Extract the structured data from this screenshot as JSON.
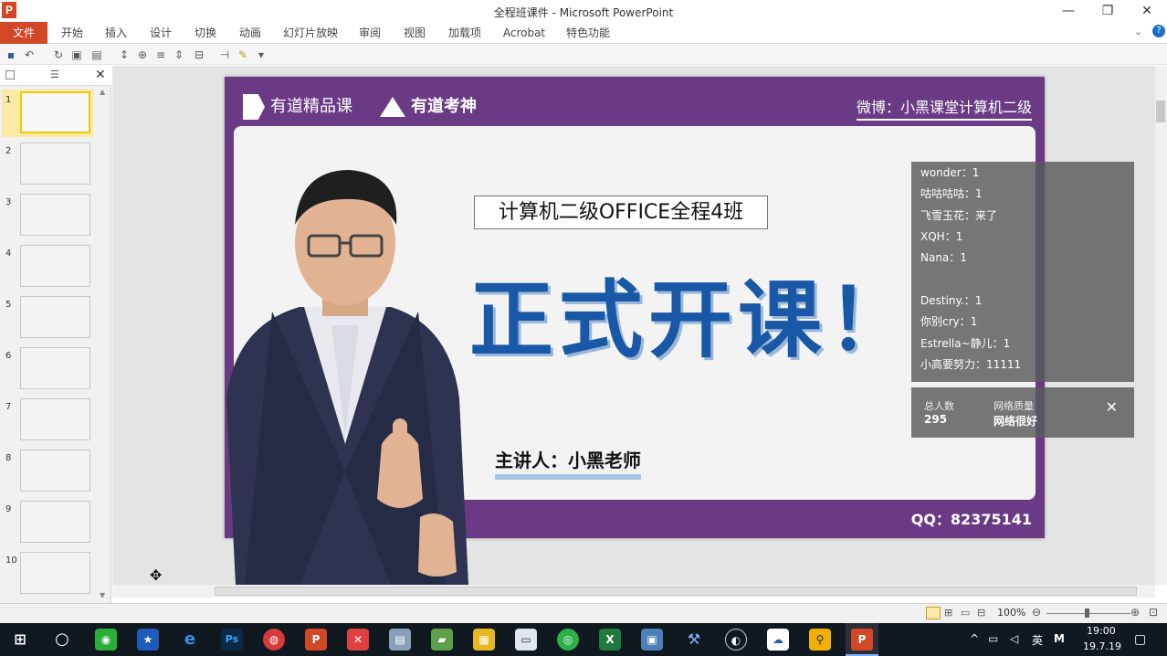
{
  "window": {
    "app_icon_letter": "P",
    "title": "全程班课件 - Microsoft PowerPoint",
    "min_glyph": "—",
    "restore_glyph": "❐",
    "close_glyph": "✕"
  },
  "ribbon": {
    "tabs": [
      "文件",
      "开始",
      "插入",
      "设计",
      "切换",
      "动画",
      "幻灯片放映",
      "审阅",
      "视图",
      "加载项",
      "Acrobat",
      "特色功能"
    ]
  },
  "thumbnails": {
    "numbers": [
      "1",
      "2",
      "3",
      "4",
      "5",
      "6",
      "7",
      "8",
      "9",
      "10"
    ],
    "active": 1
  },
  "slide": {
    "logo1": "有道精品课",
    "logo2": "有道考神",
    "weibo": "微博：小黑课堂计算机二级",
    "course_title": "计算机二级OFFICE全程4班",
    "main_title": "正式开课！",
    "presenter": "主讲人：小黑老师",
    "qq": "QQ：82375141"
  },
  "chat": {
    "messages": [
      "wonder：1",
      "咕咕咕咕：1",
      "飞雪玉花：来了",
      "XQH：1",
      "Nana：1",
      "Destiny.：1",
      "你别cry：1",
      "Estrella~静儿：1",
      "小高要努力：11111"
    ]
  },
  "stats": {
    "total_label": "总人数",
    "total_value": "295",
    "network_label": "网络质量",
    "network_value": "网络很好",
    "close_glyph": "✕"
  },
  "statusbar": {
    "zoom": "100%"
  },
  "taskbar": {
    "tray_lang": "英",
    "tray_ime": "M",
    "time": "19:00",
    "date": "19.7.19"
  },
  "colors": {
    "file_tab": "#d24726",
    "slide_purple": "#6a3a85",
    "title_blue": "#1958a6"
  }
}
